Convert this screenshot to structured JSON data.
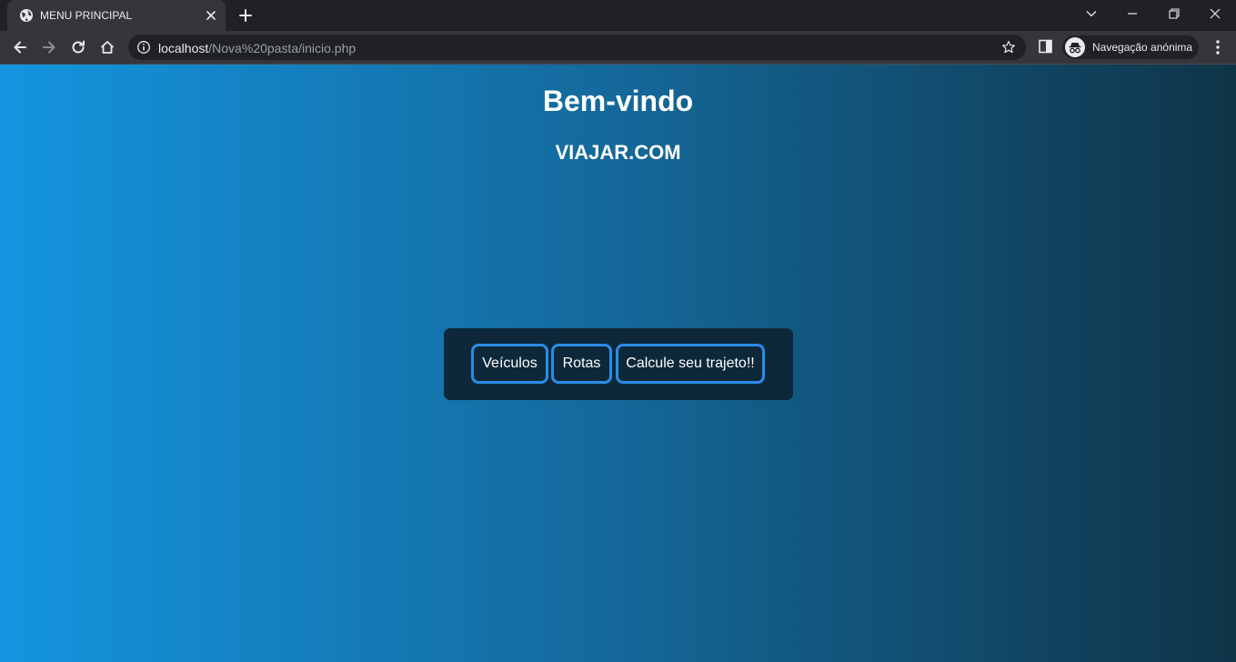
{
  "browser": {
    "tab": {
      "title": "MENU PRINCIPAL"
    },
    "address": {
      "host": "localhost",
      "path": "/Nova%20pasta/inicio.php"
    },
    "profile": {
      "label": "Navegação anónima"
    },
    "icons": [
      "globe-icon",
      "close-icon",
      "plus-icon",
      "chevron-down-icon",
      "minimize-icon",
      "restore-icon",
      "window-close-icon",
      "back-icon",
      "forward-icon",
      "reload-icon",
      "home-icon",
      "info-icon",
      "star-icon",
      "side-panel-icon",
      "incognito-icon",
      "kebab-menu-icon"
    ]
  },
  "page": {
    "title": "Bem-vindo",
    "subtitle": "VIAJAR.COM",
    "menu": [
      {
        "label": "Veículos"
      },
      {
        "label": "Rotas"
      },
      {
        "label": "Calcule seu trajeto!!"
      }
    ]
  },
  "colors": {
    "gradient_start": "#1495df",
    "gradient_end": "#0f3447",
    "menu_background": "#0d2839",
    "button_border": "#2b8ce6"
  }
}
